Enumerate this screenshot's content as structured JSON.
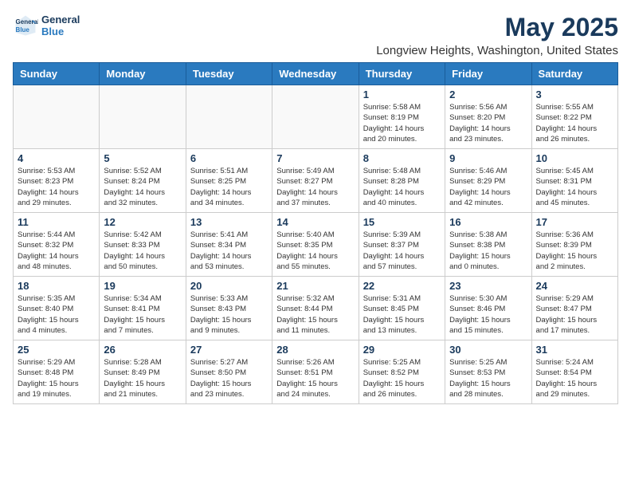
{
  "header": {
    "logo_line1": "General",
    "logo_line2": "Blue",
    "title": "May 2025",
    "subtitle": "Longview Heights, Washington, United States"
  },
  "weekdays": [
    "Sunday",
    "Monday",
    "Tuesday",
    "Wednesday",
    "Thursday",
    "Friday",
    "Saturday"
  ],
  "weeks": [
    [
      {
        "day": "",
        "info": ""
      },
      {
        "day": "",
        "info": ""
      },
      {
        "day": "",
        "info": ""
      },
      {
        "day": "",
        "info": ""
      },
      {
        "day": "1",
        "info": "Sunrise: 5:58 AM\nSunset: 8:19 PM\nDaylight: 14 hours\nand 20 minutes."
      },
      {
        "day": "2",
        "info": "Sunrise: 5:56 AM\nSunset: 8:20 PM\nDaylight: 14 hours\nand 23 minutes."
      },
      {
        "day": "3",
        "info": "Sunrise: 5:55 AM\nSunset: 8:22 PM\nDaylight: 14 hours\nand 26 minutes."
      }
    ],
    [
      {
        "day": "4",
        "info": "Sunrise: 5:53 AM\nSunset: 8:23 PM\nDaylight: 14 hours\nand 29 minutes."
      },
      {
        "day": "5",
        "info": "Sunrise: 5:52 AM\nSunset: 8:24 PM\nDaylight: 14 hours\nand 32 minutes."
      },
      {
        "day": "6",
        "info": "Sunrise: 5:51 AM\nSunset: 8:25 PM\nDaylight: 14 hours\nand 34 minutes."
      },
      {
        "day": "7",
        "info": "Sunrise: 5:49 AM\nSunset: 8:27 PM\nDaylight: 14 hours\nand 37 minutes."
      },
      {
        "day": "8",
        "info": "Sunrise: 5:48 AM\nSunset: 8:28 PM\nDaylight: 14 hours\nand 40 minutes."
      },
      {
        "day": "9",
        "info": "Sunrise: 5:46 AM\nSunset: 8:29 PM\nDaylight: 14 hours\nand 42 minutes."
      },
      {
        "day": "10",
        "info": "Sunrise: 5:45 AM\nSunset: 8:31 PM\nDaylight: 14 hours\nand 45 minutes."
      }
    ],
    [
      {
        "day": "11",
        "info": "Sunrise: 5:44 AM\nSunset: 8:32 PM\nDaylight: 14 hours\nand 48 minutes."
      },
      {
        "day": "12",
        "info": "Sunrise: 5:42 AM\nSunset: 8:33 PM\nDaylight: 14 hours\nand 50 minutes."
      },
      {
        "day": "13",
        "info": "Sunrise: 5:41 AM\nSunset: 8:34 PM\nDaylight: 14 hours\nand 53 minutes."
      },
      {
        "day": "14",
        "info": "Sunrise: 5:40 AM\nSunset: 8:35 PM\nDaylight: 14 hours\nand 55 minutes."
      },
      {
        "day": "15",
        "info": "Sunrise: 5:39 AM\nSunset: 8:37 PM\nDaylight: 14 hours\nand 57 minutes."
      },
      {
        "day": "16",
        "info": "Sunrise: 5:38 AM\nSunset: 8:38 PM\nDaylight: 15 hours\nand 0 minutes."
      },
      {
        "day": "17",
        "info": "Sunrise: 5:36 AM\nSunset: 8:39 PM\nDaylight: 15 hours\nand 2 minutes."
      }
    ],
    [
      {
        "day": "18",
        "info": "Sunrise: 5:35 AM\nSunset: 8:40 PM\nDaylight: 15 hours\nand 4 minutes."
      },
      {
        "day": "19",
        "info": "Sunrise: 5:34 AM\nSunset: 8:41 PM\nDaylight: 15 hours\nand 7 minutes."
      },
      {
        "day": "20",
        "info": "Sunrise: 5:33 AM\nSunset: 8:43 PM\nDaylight: 15 hours\nand 9 minutes."
      },
      {
        "day": "21",
        "info": "Sunrise: 5:32 AM\nSunset: 8:44 PM\nDaylight: 15 hours\nand 11 minutes."
      },
      {
        "day": "22",
        "info": "Sunrise: 5:31 AM\nSunset: 8:45 PM\nDaylight: 15 hours\nand 13 minutes."
      },
      {
        "day": "23",
        "info": "Sunrise: 5:30 AM\nSunset: 8:46 PM\nDaylight: 15 hours\nand 15 minutes."
      },
      {
        "day": "24",
        "info": "Sunrise: 5:29 AM\nSunset: 8:47 PM\nDaylight: 15 hours\nand 17 minutes."
      }
    ],
    [
      {
        "day": "25",
        "info": "Sunrise: 5:29 AM\nSunset: 8:48 PM\nDaylight: 15 hours\nand 19 minutes."
      },
      {
        "day": "26",
        "info": "Sunrise: 5:28 AM\nSunset: 8:49 PM\nDaylight: 15 hours\nand 21 minutes."
      },
      {
        "day": "27",
        "info": "Sunrise: 5:27 AM\nSunset: 8:50 PM\nDaylight: 15 hours\nand 23 minutes."
      },
      {
        "day": "28",
        "info": "Sunrise: 5:26 AM\nSunset: 8:51 PM\nDaylight: 15 hours\nand 24 minutes."
      },
      {
        "day": "29",
        "info": "Sunrise: 5:25 AM\nSunset: 8:52 PM\nDaylight: 15 hours\nand 26 minutes."
      },
      {
        "day": "30",
        "info": "Sunrise: 5:25 AM\nSunset: 8:53 PM\nDaylight: 15 hours\nand 28 minutes."
      },
      {
        "day": "31",
        "info": "Sunrise: 5:24 AM\nSunset: 8:54 PM\nDaylight: 15 hours\nand 29 minutes."
      }
    ]
  ]
}
